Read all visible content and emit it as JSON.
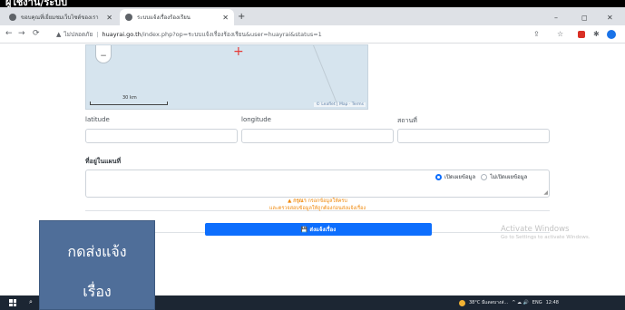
{
  "top_title": "ผู้ใช้งาน/ระบบ",
  "browser": {
    "tabs": [
      {
        "title": "ขอบคุณที่เยี่ยมชมเว็บไซต์ของเรา",
        "active": false
      },
      {
        "title": "ระบบแจ้งเรื่องร้องเรียน",
        "active": true
      }
    ],
    "new_tab": "+",
    "window_controls": {
      "minimize": "–",
      "maximize": "◻",
      "close": "✕"
    },
    "nav": {
      "back": "←",
      "forward": "→",
      "reload": "⟳"
    },
    "address": {
      "security_icon": "warning-triangle-icon",
      "not_secure": "ไม่ปลอดภัย",
      "separator": "|",
      "host": "huayrai.go.th",
      "path": "/index.php?op=ระบบแจ้งเรื่องร้องเรียน&user=huayrai&status=1"
    },
    "right_icons": {
      "share": "⇪",
      "bookmark": "☆",
      "extensions": "✱"
    }
  },
  "map": {
    "zoom_out": "−",
    "marker": "+",
    "scale_label": "30 km",
    "attribution": "© Leaflet | Map · Terms"
  },
  "form": {
    "latitude_label": "latitude",
    "longitude_label": "longitude",
    "place_label": "สถานที่",
    "address_label": "ที่อยู่ในแผนที่",
    "disclose_option": "เปิดเผยข้อมูล",
    "hide_option": "ไม่เปิดเผยข้อมูล",
    "notice_prefix": "▲ กรุณา",
    "notice_line1": "กรอกข้อมูลให้ครบ",
    "notice_line2": "และตรวจสอบข้อมูลให้ถูกต้องก่อนส่งแจ้งเรื่อง",
    "submit_label": "💾 ส่งแจ้งเรื่อง"
  },
  "windows_watermark": {
    "line1": "Activate Windows",
    "line2": "Go to Settings to activate Windows."
  },
  "overlay": {
    "line1": "กดส่งแจ้ง",
    "line2": "เรื่อง"
  },
  "taskbar": {
    "search_icon": "⌕",
    "weather": "38°C มีแดดบางส่...",
    "tray_icons": "^ ☁ 🔊",
    "language": "ENG",
    "time": "12:48"
  }
}
